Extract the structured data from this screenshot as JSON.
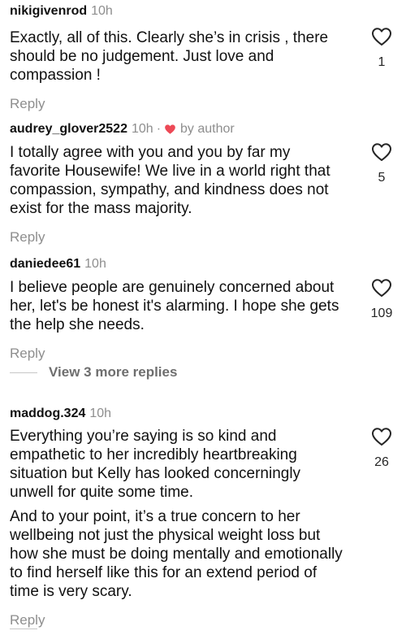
{
  "comments": [
    {
      "username": "nikigivenrod",
      "time": "10h",
      "by_author": false,
      "lines": [
        "Exactly, all of this.  Clearly she’s in crisis , there should be no judgement.  Just love and compassion !"
      ],
      "reply_label": "Reply",
      "likes": "1"
    },
    {
      "username": "audrey_glover2522",
      "time": "10h",
      "separator": "·",
      "by_author": true,
      "by_author_label": "by author",
      "lines": [
        "I totally agree with you and you by far my favorite Housewife! We live in a world right that compassion, sympathy, and kindness does not exist for the mass majority."
      ],
      "reply_label": "Reply",
      "likes": "5"
    },
    {
      "username": "daniedee61",
      "time": "10h",
      "by_author": false,
      "lines": [
        "I believe people are genuinely concerned about her, let's be honest it's alarming. I hope she gets the help she needs."
      ],
      "reply_label": "Reply",
      "likes": "109",
      "view_more_label": "View 3 more replies"
    },
    {
      "username": "maddog.324",
      "time": "10h",
      "by_author": false,
      "lines": [
        "Everything you’re saying is so kind and empathetic to her incredibly heartbreaking situation but Kelly has looked concerningly unwell for quite some time.",
        "And to your point, it’s a true concern to her wellbeing not just the physical weight loss but how she must be doing mentally and emotionally to find herself like this for an extend period of time is very scary."
      ],
      "reply_label": "Reply",
      "likes": "26"
    }
  ],
  "icons": {
    "like": "heart-outline-icon",
    "author_like": "heart-filled-icon"
  },
  "colors": {
    "text": "#111111",
    "secondary": "#8e8e8e",
    "heart_red": "#ed4956"
  }
}
